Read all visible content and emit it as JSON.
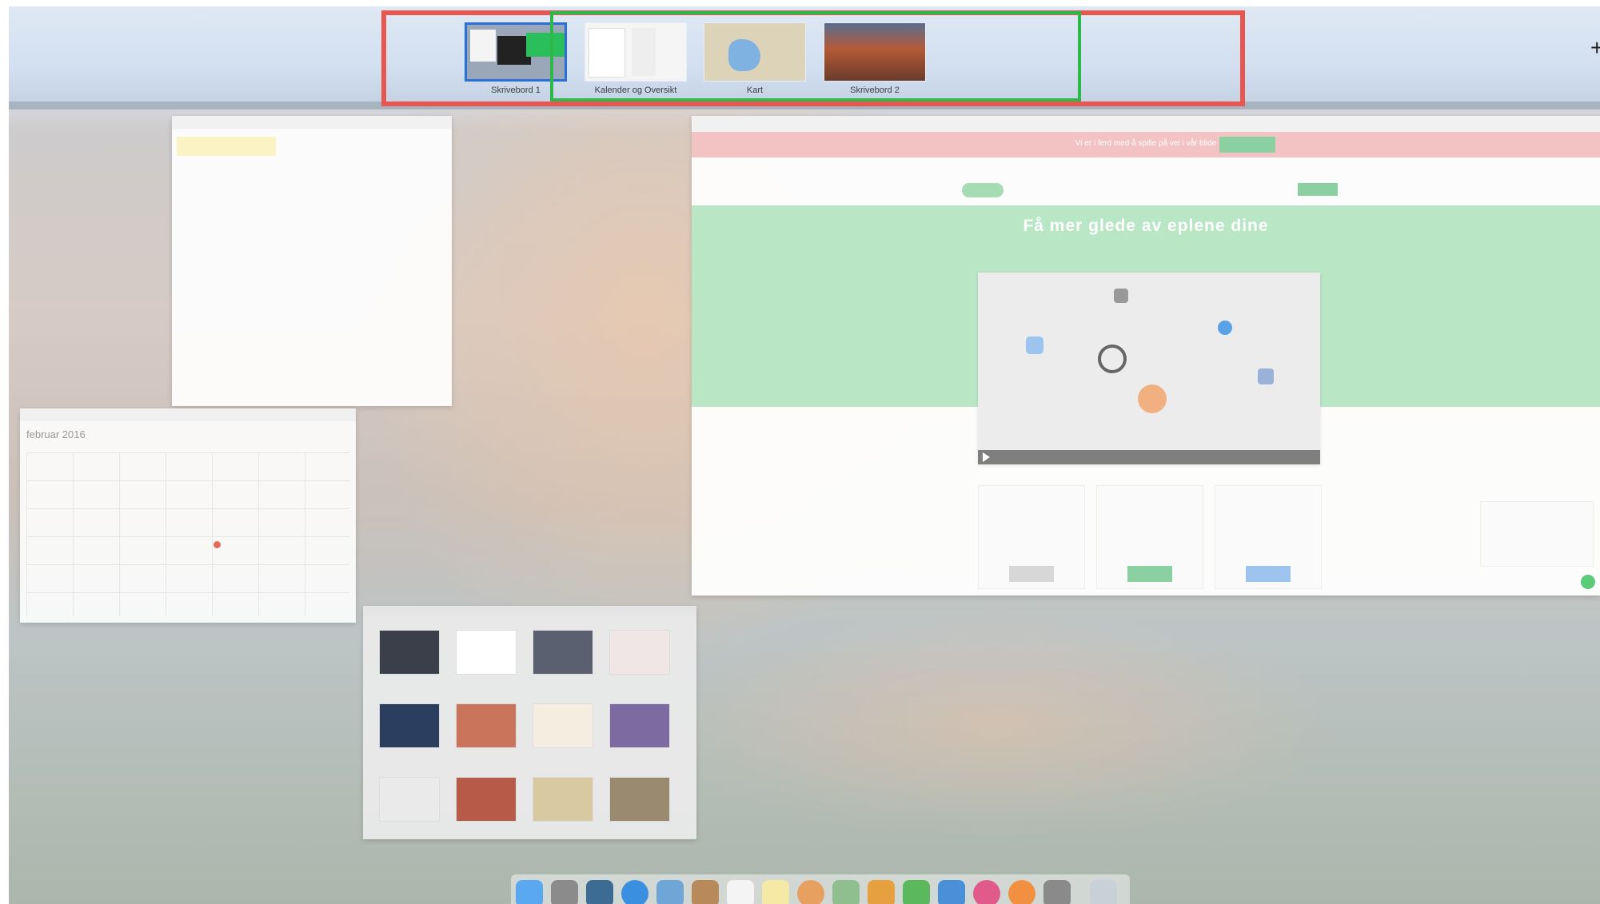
{
  "mission_control": {
    "spaces": [
      {
        "label": "Skrivebord 1"
      },
      {
        "label": "Kalender og Oversikt"
      },
      {
        "label": "Kart"
      },
      {
        "label": "Skrivebord 2"
      }
    ],
    "add_space_label": "+"
  },
  "windows": {
    "calendar": {
      "month_label": "februar 2016"
    },
    "webpage": {
      "banner_text": "Vi er i ferd med å spille på vei i vår blide",
      "hero_title": "Få mer glede av eplene dine"
    }
  },
  "dock": {
    "icons": [
      "finder-icon",
      "launchpad-icon",
      "mission-control-icon",
      "safari-icon",
      "mail-icon",
      "contacts-icon",
      "calendar-icon",
      "notes-icon",
      "photos-icon",
      "maps-icon",
      "pages-icon",
      "numbers-icon",
      "keynote-icon",
      "itunes-icon",
      "ibooks-icon",
      "system-preferences-icon",
      "trash-icon"
    ]
  },
  "colors": {
    "highlight_red": "#e8574f",
    "highlight_green": "#2eb84a",
    "selected_space": "#2b6fd9",
    "hero_green": "#b9e6c4"
  }
}
